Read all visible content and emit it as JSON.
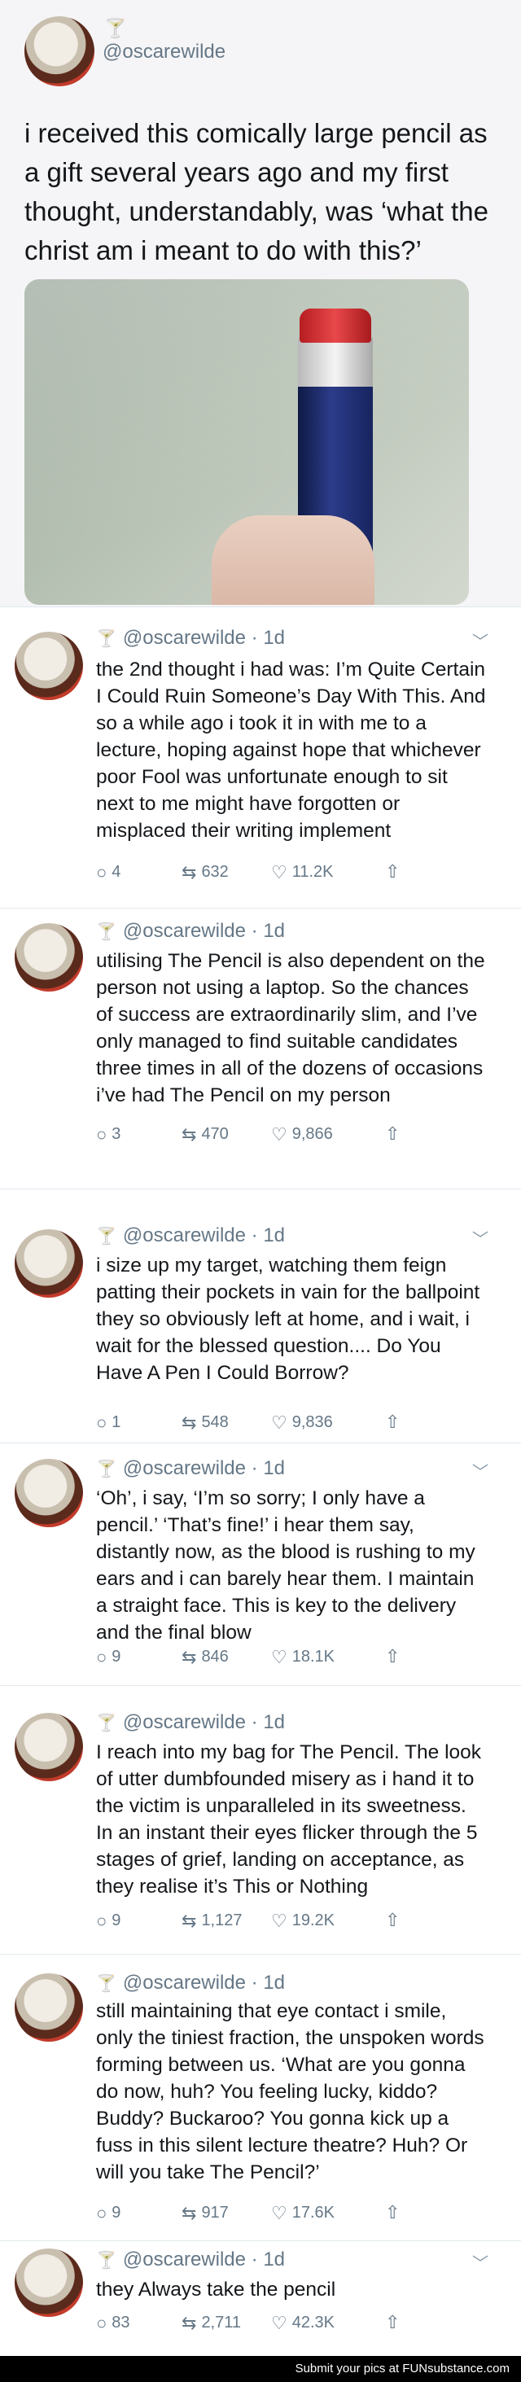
{
  "main": {
    "handle": "@oscarewilde",
    "text": "i received this comically large pencil as a gift several years ago and my first thought, understandably, was ‘what the christ am i meant to do with this?’"
  },
  "tweets": [
    {
      "handle": "@oscarewilde",
      "time": "1d",
      "text": "the 2nd thought i had was: I’m Quite Certain I Could Ruin Someone’s Day With This. And so a while ago i took it in with me to a lecture, hoping against hope that whichever poor Fool was unfortunate enough to sit next to me might have forgotten or misplaced their writing implement",
      "replies": "4",
      "retweets": "632",
      "likes": "11.2K"
    },
    {
      "handle": "@oscarewilde",
      "time": "1d",
      "text": "utilising The Pencil is also dependent on the person not using a laptop. So the chances of success are extraordinarily slim, and I’ve only managed to find suitable candidates three times in all of the dozens of occasions i’ve had The Pencil on my person",
      "replies": "3",
      "retweets": "470",
      "likes": "9,866"
    },
    {
      "handle": "@oscarewilde",
      "time": "1d",
      "text": "i size up my target, watching them feign patting their pockets in vain for the ballpoint they so obviously left at home, and i wait, i wait for the blessed question.... Do You Have A Pen I Could Borrow?",
      "replies": "1",
      "retweets": "548",
      "likes": "9,836"
    },
    {
      "handle": "@oscarewilde",
      "time": "1d",
      "text": "‘Oh’, i say, ‘I’m so sorry; I only have a pencil.’ ‘That’s fine!’ i hear them say, distantly now, as the blood is rushing to my ears and i can barely hear them. I maintain a straight face. This is key to the delivery and the final blow",
      "replies": "9",
      "retweets": "846",
      "likes": "18.1K"
    },
    {
      "handle": "@oscarewilde",
      "time": "1d",
      "text": "I reach into my bag for The Pencil. The look of utter dumbfounded misery as i hand it to the victim is unparalleled in its sweetness. In an instant their eyes flicker through the 5 stages of grief, landing on acceptance, as they realise it’s This or Nothing",
      "replies": "9",
      "retweets": "1,127",
      "likes": "19.2K"
    },
    {
      "handle": "@oscarewilde",
      "time": "1d",
      "text": "still maintaining that eye contact i smile, only the tiniest fraction, the unspoken words forming between us. ‘What are you gonna do now, huh? You feeling lucky, kiddo? Buddy? Buckaroo? You gonna kick up a fuss in this silent lecture theatre? Huh? Or will you take The Pencil?’",
      "replies": "9",
      "retweets": "917",
      "likes": "17.6K"
    },
    {
      "handle": "@oscarewilde",
      "time": "1d",
      "text": "they Always take the pencil",
      "replies": "83",
      "retweets": "2,711",
      "likes": "42.3K"
    }
  ],
  "footer": {
    "text": "Submit your pics at FUNsubstance.com"
  }
}
